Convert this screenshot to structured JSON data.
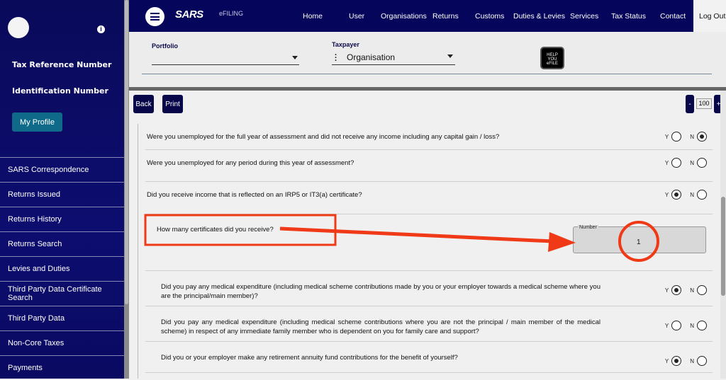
{
  "sidebar": {
    "tax_ref_label": "Tax Reference Number",
    "id_label": "Identification Number",
    "profile_button": "My Profile",
    "items": [
      "SARS Correspondence",
      "Returns Issued",
      "Returns History",
      "Returns Search",
      "Levies and Duties",
      "Third Party Data Certificate Search",
      "Third Party Data",
      "Non-Core Taxes",
      "Payments"
    ]
  },
  "header": {
    "logo": "SARS",
    "efiling": "eFILING",
    "nav": [
      "Home",
      "User",
      "Organisations",
      "Returns",
      "Customs",
      "Duties & Levies",
      "Services",
      "Tax Status",
      "Contact"
    ],
    "logout": "Log Out"
  },
  "toolbar": {
    "portfolio_label": "Portfolio",
    "taxpayer_label": "Taxpayer",
    "organisation": "Organisation",
    "help_logo": "HELP YOU eFILE"
  },
  "actions": {
    "back": "Back",
    "print": "Print",
    "zoom_minus": "-",
    "zoom_value": "100",
    "zoom_plus": "+"
  },
  "yes": "Y",
  "no": "N",
  "questions": [
    {
      "text": "Were you unemployed for the full year of assessment and did not receive any income including any capital gain / loss?",
      "answer": "N"
    },
    {
      "text": "Were you unemployed for any period during this year of assessment?",
      "answer": ""
    },
    {
      "text": "Did you receive income that is reflected on an IRP5 or IT3(a) certificate?",
      "answer": "Y"
    },
    {
      "text": "Did you pay any medical expenditure (including medical scheme contributions made by you or your employer towards a medical scheme where you are the principal/main member)?",
      "answer": "Y"
    },
    {
      "text": "Did you pay any medical expenditure (including medical scheme contributions where you are not the principal / main member of the medical scheme) in respect of any immediate family member who is dependent on you for family care and support?",
      "answer": ""
    },
    {
      "text": "Did you or your employer make any retirement annuity fund contributions for the benefit of yourself?",
      "answer": "Y"
    }
  ],
  "certificates": {
    "question": "How many certificates did you receive?",
    "field_label": "Number",
    "value": "1"
  },
  "annotation_color": "#f03a17"
}
